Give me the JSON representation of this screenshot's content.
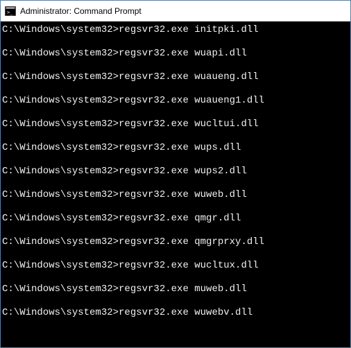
{
  "titlebar": {
    "title": "Administrator: Command Prompt"
  },
  "terminal": {
    "prompt": "C:\\Windows\\system32>",
    "command": "regsvr32.exe",
    "lines": [
      {
        "arg": "initpki.dll"
      },
      {
        "arg": "wuapi.dll"
      },
      {
        "arg": "wuaueng.dll"
      },
      {
        "arg": "wuaueng1.dll"
      },
      {
        "arg": "wucltui.dll"
      },
      {
        "arg": "wups.dll"
      },
      {
        "arg": "wups2.dll"
      },
      {
        "arg": "wuweb.dll"
      },
      {
        "arg": "qmgr.dll"
      },
      {
        "arg": "qmgrprxy.dll"
      },
      {
        "arg": "wucltux.dll"
      },
      {
        "arg": "muweb.dll"
      },
      {
        "arg": "wuwebv.dll"
      }
    ]
  }
}
